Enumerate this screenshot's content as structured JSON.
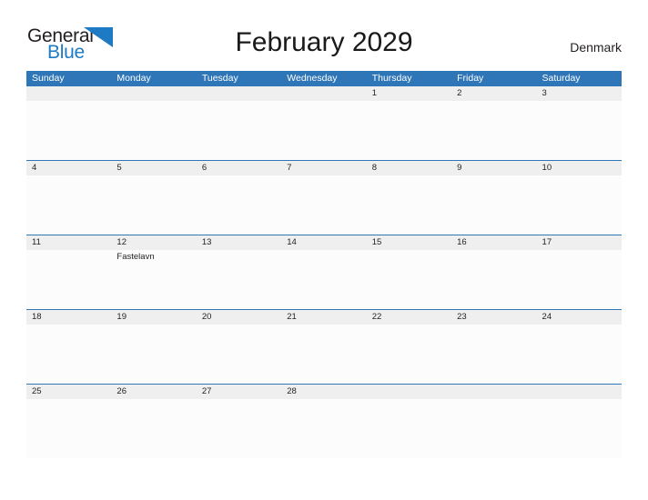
{
  "brand": {
    "name_part1": "General",
    "name_part2": "Blue",
    "logo_icon": "blue-flag-triangle",
    "color_dark": "#231f20",
    "color_blue": "#1f7ac4"
  },
  "header": {
    "title": "February 2029",
    "country": "Denmark"
  },
  "theme": {
    "header_blue": "#2e76b8",
    "band_gray": "#efefef",
    "cell_white": "#fcfcfc"
  },
  "weekdays": [
    "Sunday",
    "Monday",
    "Tuesday",
    "Wednesday",
    "Thursday",
    "Friday",
    "Saturday"
  ],
  "weeks": [
    [
      {
        "date": "",
        "events": []
      },
      {
        "date": "",
        "events": []
      },
      {
        "date": "",
        "events": []
      },
      {
        "date": "",
        "events": []
      },
      {
        "date": "1",
        "events": []
      },
      {
        "date": "2",
        "events": []
      },
      {
        "date": "3",
        "events": []
      }
    ],
    [
      {
        "date": "4",
        "events": []
      },
      {
        "date": "5",
        "events": []
      },
      {
        "date": "6",
        "events": []
      },
      {
        "date": "7",
        "events": []
      },
      {
        "date": "8",
        "events": []
      },
      {
        "date": "9",
        "events": []
      },
      {
        "date": "10",
        "events": []
      }
    ],
    [
      {
        "date": "11",
        "events": []
      },
      {
        "date": "12",
        "events": [
          "Fastelavn"
        ]
      },
      {
        "date": "13",
        "events": []
      },
      {
        "date": "14",
        "events": []
      },
      {
        "date": "15",
        "events": []
      },
      {
        "date": "16",
        "events": []
      },
      {
        "date": "17",
        "events": []
      }
    ],
    [
      {
        "date": "18",
        "events": []
      },
      {
        "date": "19",
        "events": []
      },
      {
        "date": "20",
        "events": []
      },
      {
        "date": "21",
        "events": []
      },
      {
        "date": "22",
        "events": []
      },
      {
        "date": "23",
        "events": []
      },
      {
        "date": "24",
        "events": []
      }
    ],
    [
      {
        "date": "25",
        "events": []
      },
      {
        "date": "26",
        "events": []
      },
      {
        "date": "27",
        "events": []
      },
      {
        "date": "28",
        "events": []
      },
      {
        "date": "",
        "events": []
      },
      {
        "date": "",
        "events": []
      },
      {
        "date": "",
        "events": []
      }
    ]
  ]
}
